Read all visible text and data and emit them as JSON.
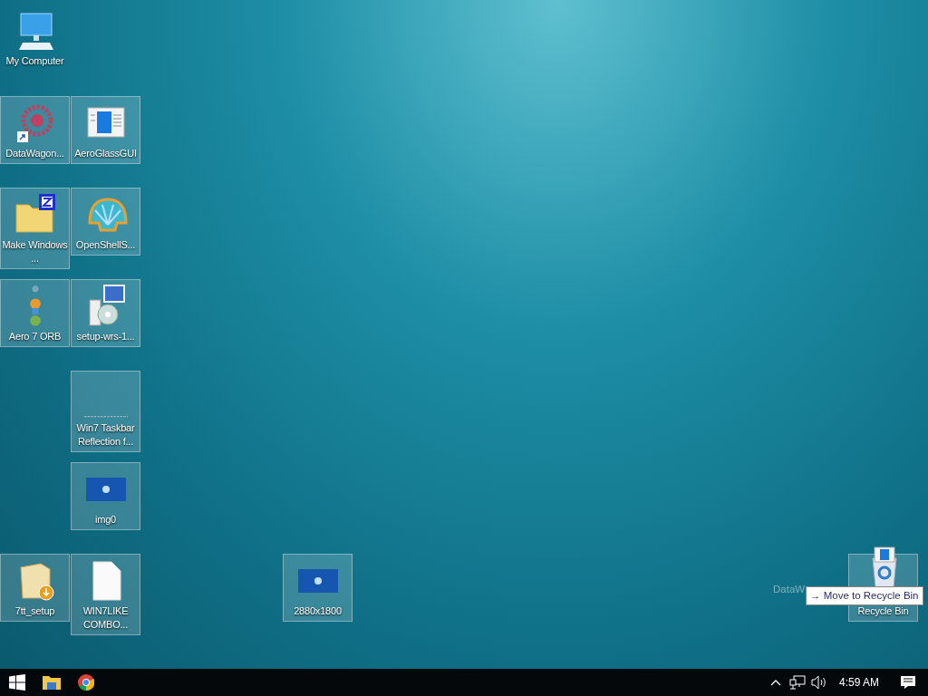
{
  "desktop": {
    "icons": [
      {
        "label": "My Computer",
        "kind": "computer",
        "selected": false
      },
      {
        "label": "DataWagon...",
        "kind": "wagon",
        "selected": true
      },
      {
        "label": "AeroGlassGUI",
        "kind": "window",
        "selected": true
      },
      {
        "label": "Make Windows ...",
        "kind": "zipfolder",
        "selected": true
      },
      {
        "label": "OpenShellS...",
        "kind": "shell",
        "selected": true
      },
      {
        "label": "Aero 7 ORB",
        "kind": "orbs",
        "selected": true
      },
      {
        "label": "setup-wrs-1...",
        "kind": "installer",
        "selected": true
      },
      {
        "label": "Win7 Taskbar Reflection f...",
        "kind": "strip",
        "selected": true
      },
      {
        "label": "img0",
        "kind": "picture",
        "selected": true
      },
      {
        "label": "7tt_setup",
        "kind": "package",
        "selected": true
      },
      {
        "label": "WIN7LIKE COMBO...",
        "kind": "document",
        "selected": true
      },
      {
        "label": "2880x1800",
        "kind": "picture",
        "selected": true
      },
      {
        "label": "Recycle Bin",
        "kind": "recycle",
        "selected": true
      }
    ],
    "drag": {
      "ghost_label": "DataW",
      "tooltip_glyph": "→",
      "tooltip": "Move to Recycle Bin"
    }
  },
  "taskbar": {
    "pinned": [
      {
        "kind": "start"
      },
      {
        "kind": "explorer"
      },
      {
        "kind": "browser"
      }
    ],
    "tray": {
      "clock": "4:59 AM"
    }
  }
}
